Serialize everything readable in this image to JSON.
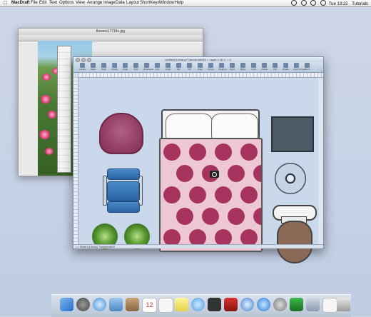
{
  "menubar": {
    "app_name": "MacDraft",
    "menus": [
      "File",
      "Edit",
      "Text",
      "Options",
      "View",
      "Arrange",
      "Image",
      "Data",
      "Layout",
      "ShortKeys",
      "Window",
      "Help"
    ],
    "clock": "Tue 13:22",
    "user": "Tutorials"
  },
  "image_window": {
    "title": "flowers17718c.jpg"
  },
  "doc_window": {
    "title": "Untitled (Library)*Tutorial.mdd10 > Layer-1 @ 1\" = 1'",
    "toolbar_labels": [
      "Layers",
      "Save",
      "Open",
      "Library",
      "Snap",
      "Grid",
      "Dimension",
      "Line",
      "Color",
      "Pen",
      "Fill",
      "Align",
      "Group",
      "Ungroup",
      "Send",
      "Bring",
      "Lock",
      "Unlock",
      "Flip",
      "Rotate",
      "Layer Props",
      "Zoom"
    ],
    "status": "< > Sheet1 (Library) Tutorial.mdd10"
  },
  "colors": {
    "accent": "#4a8bc7",
    "quilt_dot": "#a6345e",
    "chair": "#8f3b5f",
    "canvas": "#c9d8ea"
  },
  "dock": {
    "icons": [
      "finder-icon",
      "launchpad-icon",
      "safari-icon",
      "mail-icon",
      "contacts-icon",
      "calendar-icon",
      "notes-icon",
      "reminders-icon",
      "messages-icon",
      "facetime-icon",
      "photobooth-icon",
      "itunes-icon",
      "appstore-icon",
      "preferences-icon",
      "macdraft-icon",
      "utility-icon",
      "document-icon",
      "trash-icon"
    ]
  }
}
